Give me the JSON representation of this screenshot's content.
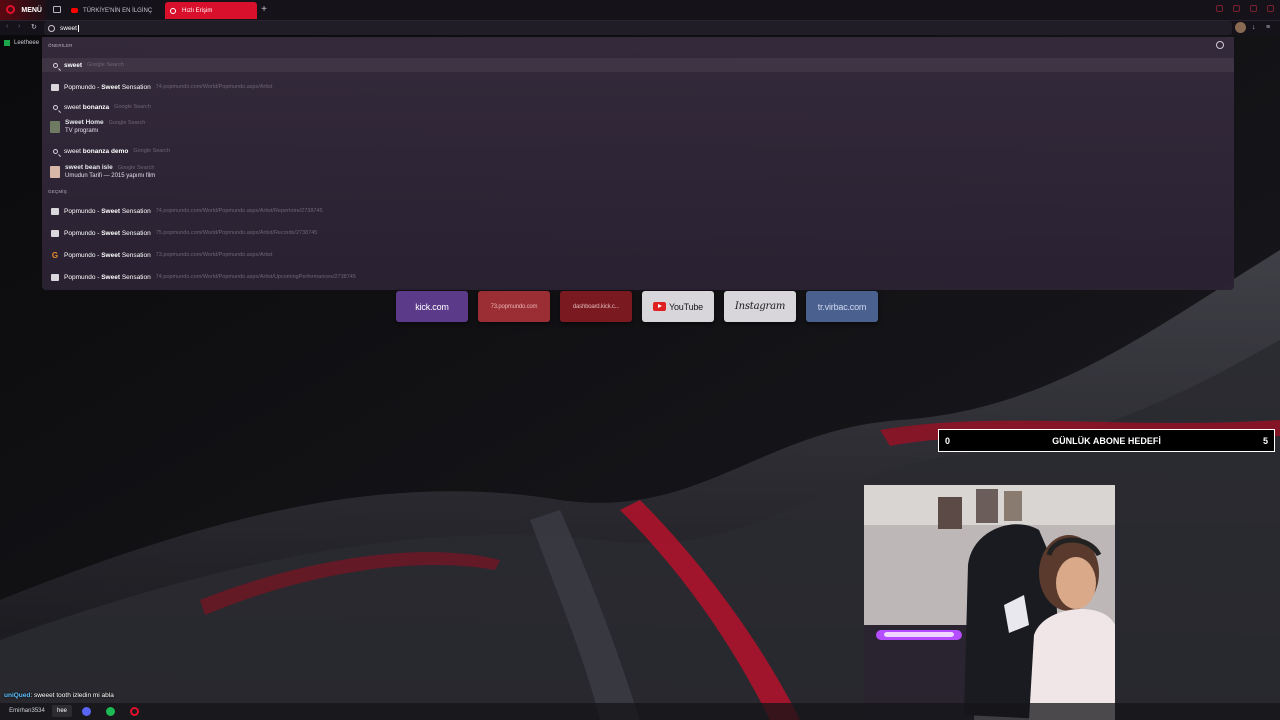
{
  "colors": {
    "accent": "#d9102b",
    "dropdown_bg": "#342a3c",
    "goal_bg": "#000000"
  },
  "tab_bar": {
    "menu_label": "MENÜ",
    "tabs": [
      {
        "label": "TÜRKİYE'NİN EN İLGİNÇ",
        "icon": "youtube-icon",
        "active": false
      },
      {
        "label": "Hızlı Erişim",
        "icon": "opera-gx-icon",
        "active": true
      }
    ],
    "new_tab_symbol": "+"
  },
  "address_bar": {
    "value": "sweet"
  },
  "bookmarks": [
    {
      "label": "Leetheee",
      "icon": "bookmark-icon"
    }
  ],
  "suggestions": {
    "section_suggestions": "ÖNERİLER",
    "section_history": "GEÇMİŞ",
    "items": [
      {
        "title": "sweet",
        "sub": "Google Search",
        "icon": "search-icon"
      },
      {
        "title_prefix": "Popmundo - ",
        "title_bold": "Sweet",
        "title_suffix": " Sensation",
        "sub": "74.popmundo.com/World/Popmundo.aspx/Artist",
        "icon": "popmundo-icon"
      },
      {
        "title_prefix": "sweet ",
        "title_bold": "bonanza",
        "sub": "Google Search",
        "icon": "search-icon"
      },
      {
        "title": "Sweet Home",
        "sub": "Google Search",
        "line2": "TV programı",
        "icon": "thumbnail-icon"
      },
      {
        "title_prefix": "sweet ",
        "title_bold": "bonanza demo",
        "sub": "Google Search",
        "icon": "search-icon"
      },
      {
        "title": "sweet bean isle",
        "sub": "Google Search",
        "line2": "Umudun Tarifi — 2015 yapımı film",
        "icon": "thumbnail-icon"
      }
    ],
    "history": [
      {
        "title_prefix": "Popmundo - ",
        "title_bold": "Sweet",
        "title_suffix": " Sensation",
        "sub": "74.popmundo.com/World/Popmundo.aspx/Artist/Repertoire/2738745",
        "icon": "popmundo-icon"
      },
      {
        "title_prefix": "Popmundo - ",
        "title_bold": "Sweet",
        "title_suffix": " Sensation",
        "sub": "75.popmundo.com/World/Popmundo.aspx/Artist/Records/2738745",
        "icon": "popmundo-icon"
      },
      {
        "title_prefix": "Popmundo - ",
        "title_bold": "Sweet",
        "title_suffix": " Sensation",
        "sub": "73.popmundo.com/World/Popmundo.aspx/Artist",
        "icon": "google-icon"
      },
      {
        "title_prefix": "Popmundo - ",
        "title_bold": "Sweet",
        "title_suffix": " Sensation",
        "sub": "74.popmundo.com/World/Popmundo.aspx/Artist/UpcomingPerformances/2738745",
        "icon": "popmundo-icon"
      }
    ]
  },
  "speed_dial": [
    {
      "label": "kick.com"
    },
    {
      "label": "73.popmundo.com"
    },
    {
      "label": "dashboard.kick.c..."
    },
    {
      "label": "YouTube",
      "icon": "youtube-icon"
    },
    {
      "label": "Instagram"
    },
    {
      "label": "tr.virbac.com"
    }
  ],
  "goal_overlay": {
    "left": "0",
    "title": "GÜNLÜK ABONE HEDEFİ",
    "right": "5"
  },
  "chat": {
    "user": "uniQued",
    "message": ": sweeet tooth izledin mi abla"
  },
  "taskbar": {
    "user_label": "Emirhan3534",
    "hee_label": "hee"
  }
}
